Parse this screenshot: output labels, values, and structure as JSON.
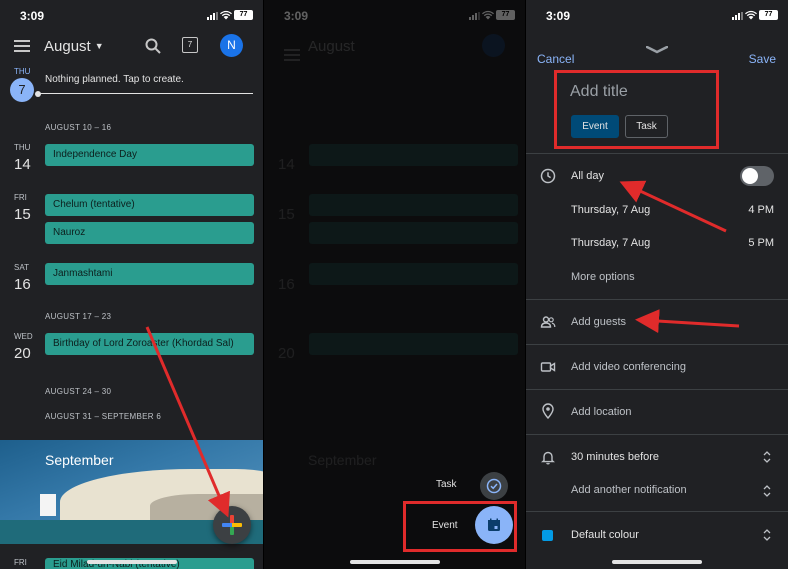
{
  "status": {
    "time": "3:09",
    "battery": "77"
  },
  "panel1": {
    "month": "August",
    "avatar": "N",
    "cal_icon_day": "7",
    "today": {
      "dow": "THU",
      "day": "7",
      "text": "Nothing planned. Tap to create."
    },
    "ranges": [
      "AUGUST 10 – 16",
      "AUGUST 17 – 23",
      "AUGUST 24 – 30",
      "AUGUST 31 – SEPTEMBER 6"
    ],
    "days": [
      {
        "dow": "THU",
        "day": "14",
        "events": [
          "Independence Day"
        ]
      },
      {
        "dow": "FRI",
        "day": "15",
        "events": [
          "Chelum (tentative)",
          "Nauroz"
        ]
      },
      {
        "dow": "SAT",
        "day": "16",
        "events": [
          "Janmashtami"
        ]
      },
      {
        "dow": "WED",
        "day": "20",
        "events": [
          "Birthday of Lord Zoroaster (Khordad Sal)"
        ]
      }
    ],
    "banner_month": "September",
    "bottom": {
      "dow": "FRI",
      "event": "Eid Milad-un-Nabi (tentative)"
    }
  },
  "panel2": {
    "task_label": "Task",
    "event_label": "Event"
  },
  "panel3": {
    "cancel": "Cancel",
    "save": "Save",
    "title_placeholder": "Add title",
    "seg_event": "Event",
    "seg_task": "Task",
    "all_day": "All day",
    "start_date": "Thursday, 7 Aug",
    "start_time": "4 PM",
    "end_date": "Thursday, 7 Aug",
    "end_time": "5 PM",
    "more_options": "More options",
    "add_guests": "Add guests",
    "add_video": "Add video conferencing",
    "add_location": "Add location",
    "notification": "30 minutes before",
    "add_notification": "Add another notification",
    "colour": "Default colour",
    "colour_hex": "#039be5"
  },
  "colors": {
    "accent": "#8ab4f8",
    "event_chip": "#2a9d8f",
    "annotation": "#e02b2b"
  }
}
